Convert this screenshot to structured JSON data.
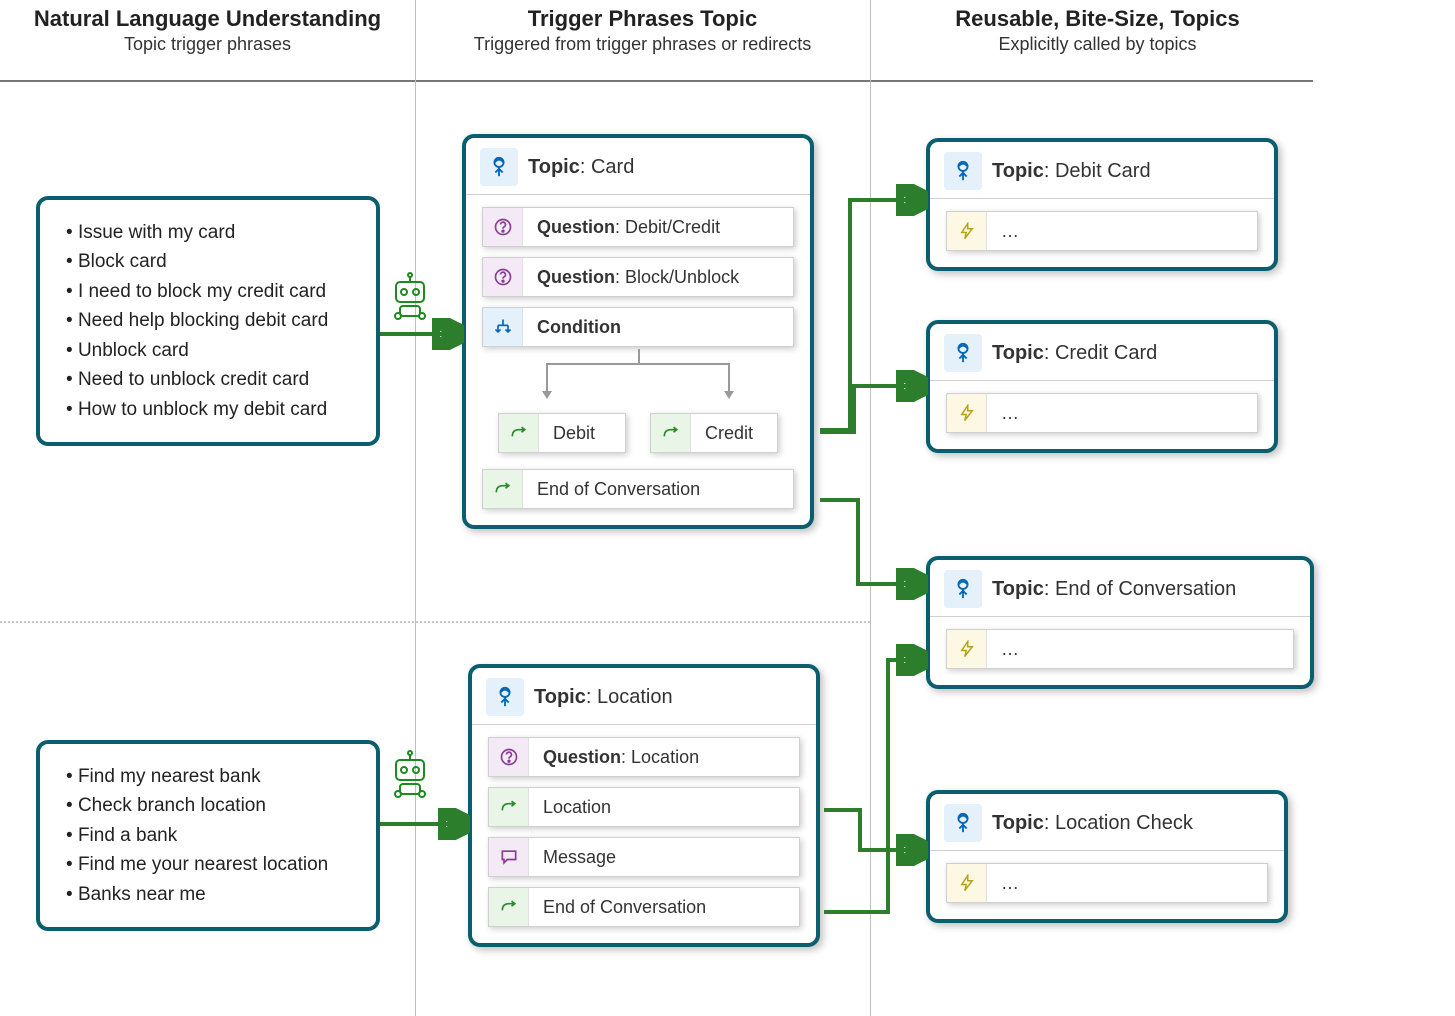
{
  "columns": [
    {
      "title": "Natural Language Understanding",
      "sub": "Topic trigger phrases"
    },
    {
      "title": "Trigger Phrases Topic",
      "sub": "Triggered from trigger phrases or redirects"
    },
    {
      "title": "Reusable, Bite-Size, Topics",
      "sub": "Explicitly called by topics"
    }
  ],
  "phrases_card": [
    "Issue with my card",
    "Block card",
    "I need to block my credit card",
    "Need help blocking debit card",
    "Unblock card",
    "Need to unblock credit card",
    "How to unblock my debit card"
  ],
  "phrases_location": [
    "Find my nearest bank",
    "Check branch location",
    "Find a bank",
    "Find me your nearest location",
    "Banks near me"
  ],
  "topic_card": {
    "title_label": "Topic",
    "title_value": "Card",
    "q1_label": "Question",
    "q1_value": "Debit/Credit",
    "q2_label": "Question",
    "q2_value": "Block/Unblock",
    "cond": "Condition",
    "branch_left": "Debit",
    "branch_right": "Credit",
    "eoc": "End of Conversation"
  },
  "topic_location": {
    "title_label": "Topic",
    "title_value": "Location",
    "q_label": "Question",
    "q_value": "Location",
    "loc": "Location",
    "msg": "Message",
    "eoc": "End of Conversation"
  },
  "reusable": {
    "debit": {
      "title_label": "Topic",
      "title_value": "Debit Card",
      "content": "…"
    },
    "credit": {
      "title_label": "Topic",
      "title_value": "Credit Card",
      "content": "…"
    },
    "eoc": {
      "title_label": "Topic",
      "title_value": "End of Conversation",
      "content": "…"
    },
    "loc": {
      "title_label": "Topic",
      "title_value": "Location Check",
      "content": "…"
    }
  }
}
